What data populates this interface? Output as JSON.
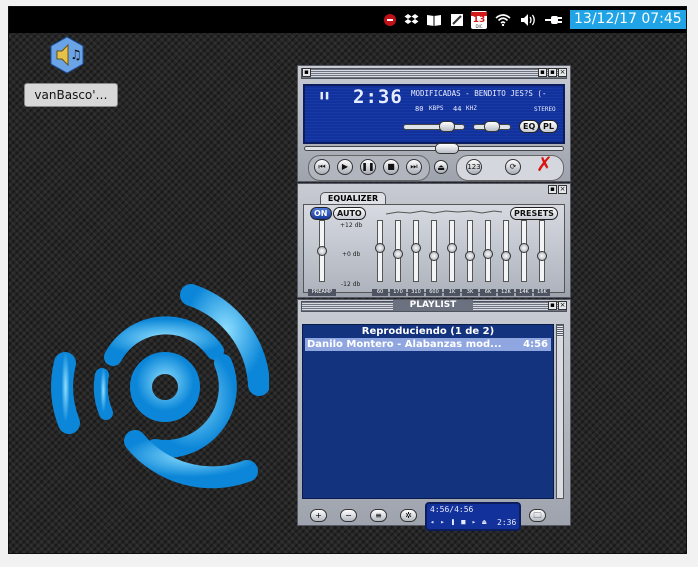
{
  "panel": {
    "clock": "13/12/17 07:45",
    "tray_icons": [
      "record-icon",
      "dropbox-icon",
      "book-icon",
      "notes-icon",
      "calendar-icon",
      "wifi-icon",
      "volume-icon",
      "power-plug-icon"
    ],
    "calendar_day": "13",
    "calendar_month": "DIC"
  },
  "desktop": {
    "icon_label": "vanBasco'…"
  },
  "winamp": {
    "main": {
      "time": "2:36",
      "title": "MODIFICADAS - BENDITO JES?S (-",
      "kbps": "80",
      "kbps_unit": "KBPS",
      "khz": "44",
      "khz_unit": "KHZ",
      "mode": "STEREO",
      "eq_button": "EQ",
      "pl_button": "PL",
      "volume_level": 0.72,
      "seek_position": 0.55
    },
    "equalizer": {
      "title": "EQUALIZER",
      "on": "ON",
      "auto": "AUTO",
      "presets": "PRESETS",
      "db_top": "+12 db",
      "db_mid": "+0 db",
      "db_bottom": "-12 db",
      "preamp_label": "PREAMP",
      "bands": [
        {
          "label": "60",
          "level": 0.55
        },
        {
          "label": "170",
          "level": 0.45
        },
        {
          "label": "310",
          "level": 0.55
        },
        {
          "label": "600",
          "level": 0.4
        },
        {
          "label": "1K",
          "level": 0.55
        },
        {
          "label": "3K",
          "level": 0.4
        },
        {
          "label": "6K",
          "level": 0.45
        },
        {
          "label": "12K",
          "level": 0.4
        },
        {
          "label": "14K",
          "level": 0.55
        },
        {
          "label": "16K",
          "level": 0.4
        }
      ],
      "preamp_level": 0.5
    },
    "playlist": {
      "title": "PLAYLIST",
      "header": "Reproduciendo (1 de 2)",
      "items": [
        {
          "name": "Danilo Montero - Alabanzas mod...",
          "length": "4:56"
        }
      ],
      "mini_time": "4:56/4:56",
      "mini_elapsed": "2:36"
    }
  }
}
